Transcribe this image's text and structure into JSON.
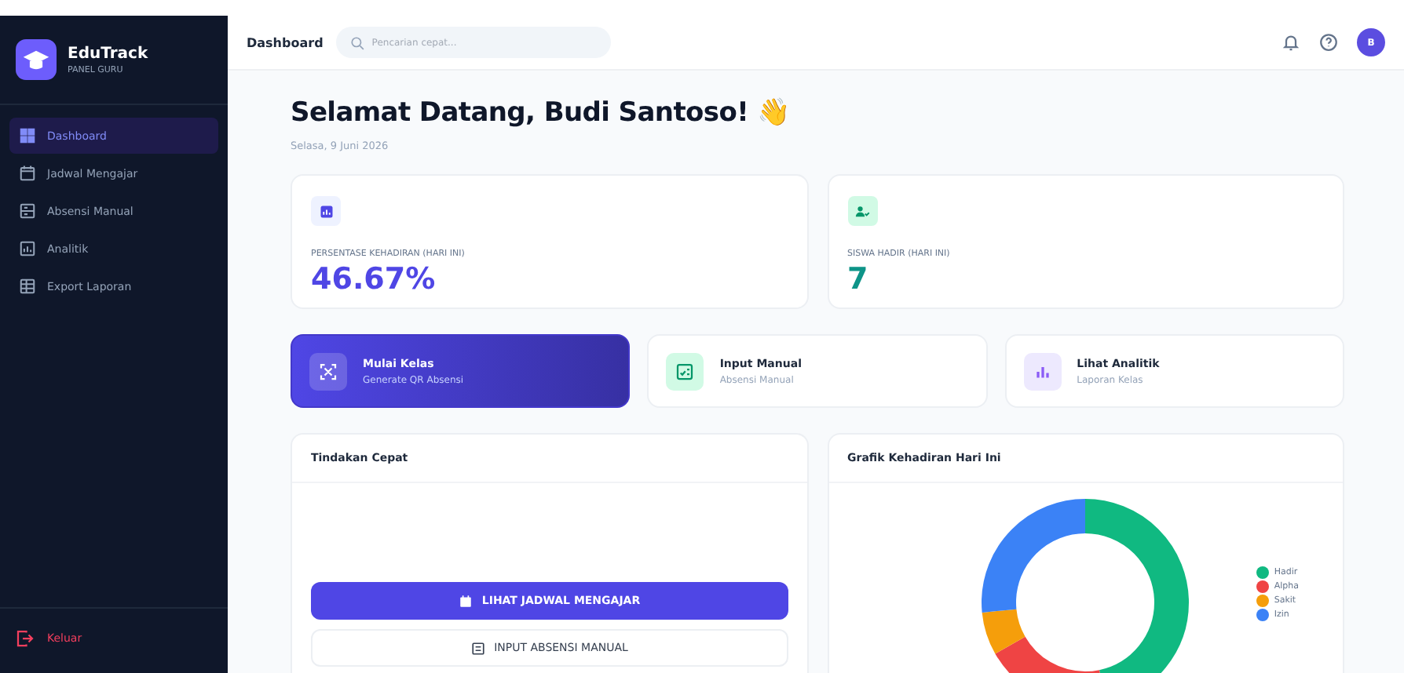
{
  "sidebar": {
    "brand": "EduTrack",
    "subtitle": "PANEL GURU",
    "items": [
      {
        "label": "Dashboard",
        "kind": "overview",
        "selected": true
      },
      {
        "label": "Jadwal Mengajar",
        "kind": "schedule",
        "selected": false
      },
      {
        "label": "Absensi Manual",
        "kind": "attendance",
        "selected": false
      },
      {
        "label": "Analitik",
        "kind": "analytics",
        "selected": false
      },
      {
        "label": "Export Laporan",
        "kind": "export",
        "selected": false
      }
    ],
    "logout": "Keluar"
  },
  "header": {
    "title": "Dashboard",
    "search": {
      "placeholder": "Pencarian cepat..."
    },
    "avatar": "B"
  },
  "welcome": {
    "title": "Selamat Datang, Budi Santoso! 👋",
    "date": "Selasa, 9 Juni 2026"
  },
  "stats": [
    {
      "label": "PERSENTASE KEHADIRAN (HARI INI)",
      "value": "46.67%",
      "kind": "percent"
    },
    {
      "label": "SISWA HADIR (HARI INI)",
      "value": "7",
      "kind": "count"
    }
  ],
  "actions": [
    {
      "title": "Mulai Kelas",
      "subtitle": "Generate QR Absensi",
      "kind": "primary"
    },
    {
      "title": "Input Manual",
      "subtitle": "Absensi Manual",
      "kind": "manual"
    },
    {
      "title": "Lihat Analitik",
      "subtitle": "Laporan Kelas",
      "kind": "analytics"
    }
  ],
  "quick_actions": {
    "title": "Tindakan Cepat",
    "buttons": [
      {
        "label": "LIHAT JADWAL MENGAJAR",
        "kind": "primary"
      },
      {
        "label": "INPUT ABSENSI MANUAL",
        "kind": "secondary"
      }
    ]
  },
  "attendance_chart": {
    "title": "Grafik Kehadiran Hari Ini",
    "legend": [
      {
        "label": "Hadir",
        "color": "#10b981"
      },
      {
        "label": "Alpha",
        "color": "#ef4444"
      },
      {
        "label": "Sakit",
        "color": "#f59e0b"
      },
      {
        "label": "Izin",
        "color": "#3b82f6"
      }
    ]
  }
}
